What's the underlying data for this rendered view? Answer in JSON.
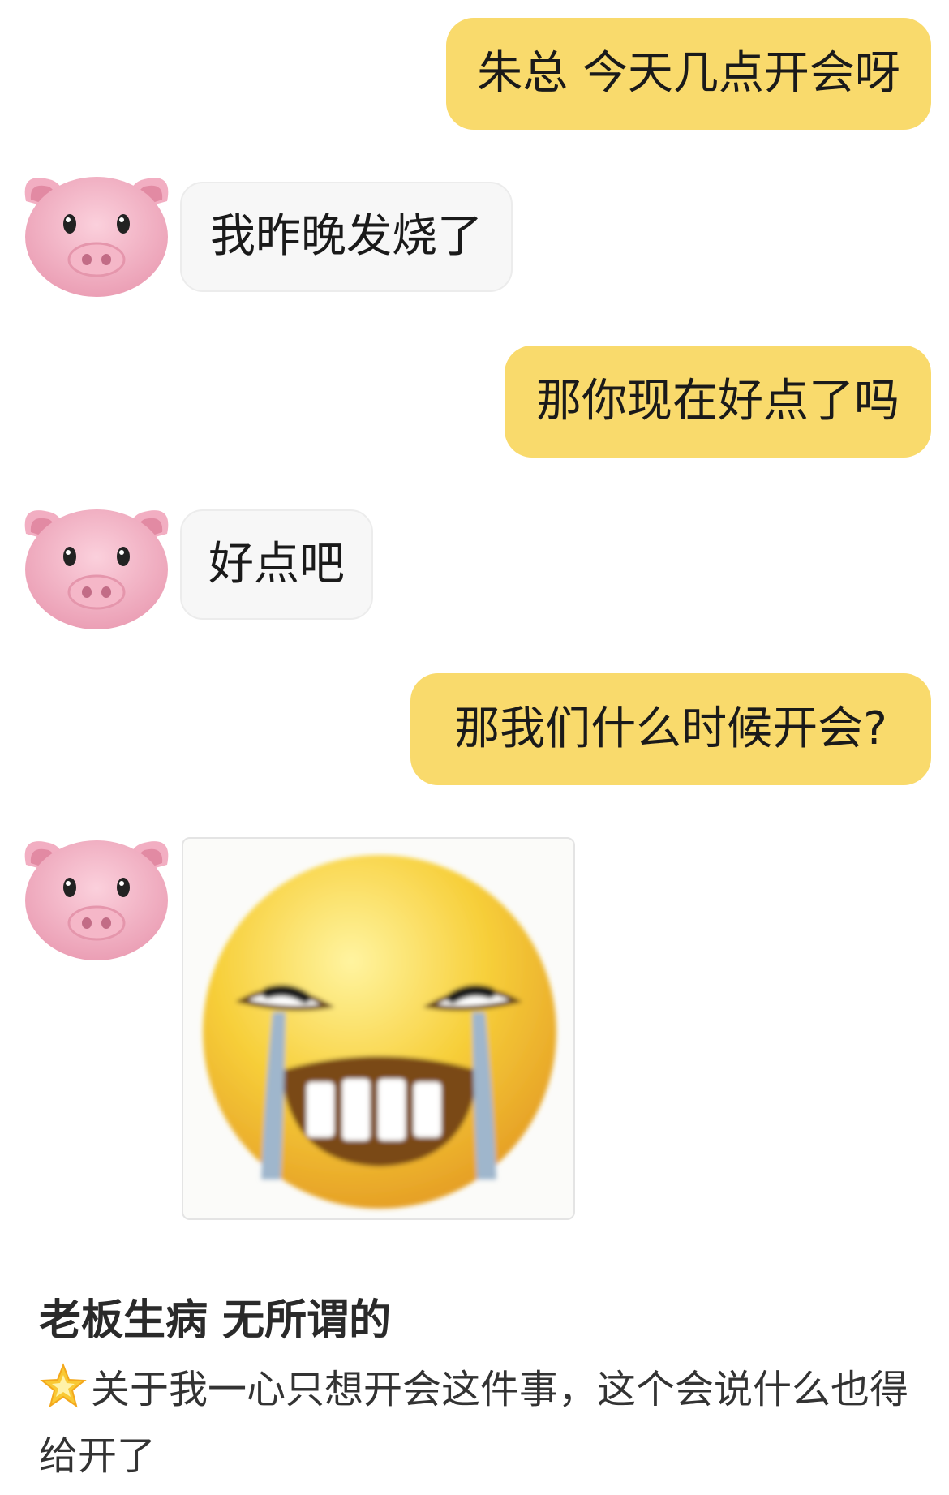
{
  "chat": {
    "messages": [
      {
        "side": "out",
        "text": "朱总 今天几点开会呀"
      },
      {
        "side": "in",
        "text": "我昨晚发烧了"
      },
      {
        "side": "out",
        "text": "那你现在好点了吗"
      },
      {
        "side": "in",
        "text": "好点吧"
      },
      {
        "side": "out",
        "text": "那我们什么时候开会?"
      },
      {
        "side": "in",
        "type": "image",
        "image": "crying-laughing-emoji"
      }
    ],
    "avatar_icon": "pig-face-icon",
    "colors": {
      "outgoing_bubble": "#f9da6c",
      "incoming_bubble": "#f7f7f7"
    }
  },
  "post": {
    "title": "老板生病 无所谓的",
    "body_icon": "glowing-star-icon",
    "body": "关于我一心只想开会这件事，这个会说什么也得给开了"
  }
}
